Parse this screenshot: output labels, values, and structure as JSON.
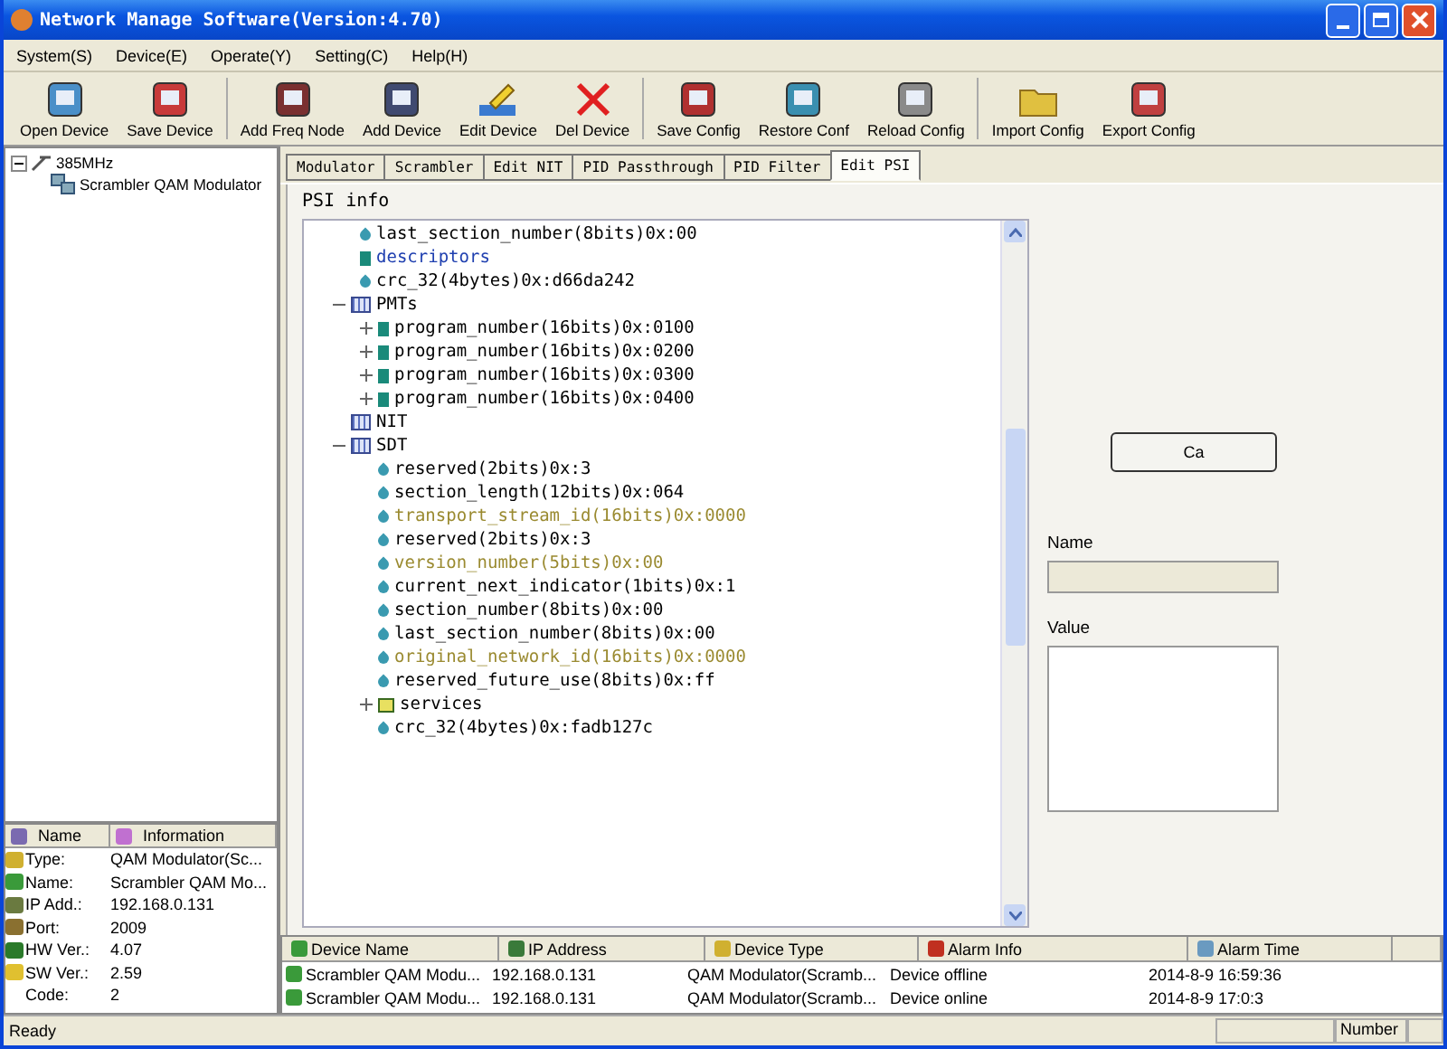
{
  "window": {
    "title": "Network Manage Software(Version:4.70)"
  },
  "menu": [
    "System(S)",
    "Device(E)",
    "Operate(Y)",
    "Setting(C)",
    "Help(H)"
  ],
  "toolbar": [
    {
      "label": "Open Device"
    },
    {
      "label": "Save Device"
    },
    {
      "label": "Add Freq Node"
    },
    {
      "label": "Add Device"
    },
    {
      "label": "Edit Device"
    },
    {
      "label": "Del Device"
    },
    {
      "label": "Save Config"
    },
    {
      "label": "Restore Conf"
    },
    {
      "label": "Reload Config"
    },
    {
      "label": "Import Config"
    },
    {
      "label": "Export Config"
    }
  ],
  "device_tree": {
    "root": {
      "label": "385MHz",
      "expanded": true,
      "children": [
        {
          "label": "Scrambler QAM Modulator"
        }
      ]
    }
  },
  "info": {
    "columns": [
      "Name",
      "Information"
    ],
    "rows": [
      {
        "name": "Type:",
        "value": "QAM Modulator(Sc..."
      },
      {
        "name": "Name:",
        "value": "Scrambler QAM Mo..."
      },
      {
        "name": "IP Add.:",
        "value": "192.168.0.131"
      },
      {
        "name": "Port:",
        "value": "2009"
      },
      {
        "name": "HW Ver.:",
        "value": "4.07"
      },
      {
        "name": "SW Ver.:",
        "value": "2.59"
      },
      {
        "name": "Code:",
        "value": "2"
      }
    ]
  },
  "tabs": [
    {
      "label": "Modulator",
      "selected": false
    },
    {
      "label": "Scrambler",
      "selected": false
    },
    {
      "label": "Edit NIT",
      "selected": false
    },
    {
      "label": "PID Passthrough",
      "selected": false
    },
    {
      "label": "PID Filter",
      "selected": false
    },
    {
      "label": "Edit PSI",
      "selected": true
    }
  ],
  "psi": {
    "title": "PSI info",
    "tree": {
      "continued_items": [
        {
          "label": "last_section_number(8bits)0x:00",
          "kind": "field",
          "highlighted": false
        },
        {
          "label": "descriptors",
          "kind": "descriptor",
          "highlighted": false
        },
        {
          "label": "crc_32(4bytes)0x:d66da242",
          "kind": "field",
          "highlighted": false
        }
      ],
      "nodes": [
        {
          "label": "PMTs",
          "kind": "table",
          "expanded": true,
          "children": [
            {
              "label": "program_number(16bits)0x:0100",
              "kind": "entry",
              "expanded": false,
              "highlighted": false
            },
            {
              "label": "program_number(16bits)0x:0200",
              "kind": "entry",
              "expanded": false,
              "highlighted": false
            },
            {
              "label": "program_number(16bits)0x:0300",
              "kind": "entry",
              "expanded": false,
              "highlighted": false
            },
            {
              "label": "program_number(16bits)0x:0400",
              "kind": "entry",
              "expanded": false,
              "highlighted": false
            }
          ]
        },
        {
          "label": "NIT",
          "kind": "table"
        },
        {
          "label": "SDT",
          "kind": "table",
          "expanded": true,
          "children": [
            {
              "label": "reserved(2bits)0x:3",
              "kind": "field",
              "highlighted": false
            },
            {
              "label": "section_length(12bits)0x:064",
              "kind": "field",
              "highlighted": false
            },
            {
              "label": "transport_stream_id(16bits)0x:0000",
              "kind": "field",
              "highlighted": true
            },
            {
              "label": "reserved(2bits)0x:3",
              "kind": "field",
              "highlighted": false
            },
            {
              "label": "version_number(5bits)0x:00",
              "kind": "field",
              "highlighted": true
            },
            {
              "label": "current_next_indicator(1bits)0x:1",
              "kind": "field",
              "highlighted": false
            },
            {
              "label": "section_number(8bits)0x:00",
              "kind": "field",
              "highlighted": false
            },
            {
              "label": "last_section_number(8bits)0x:00",
              "kind": "field",
              "highlighted": false
            },
            {
              "label": "original_network_id(16bits)0x:0000",
              "kind": "field",
              "highlighted": true
            },
            {
              "label": "reserved_future_use(8bits)0x:ff",
              "kind": "field",
              "highlighted": false
            },
            {
              "label": "services",
              "kind": "folder",
              "expanded": false,
              "highlighted": false
            },
            {
              "label": "crc_32(4bytes)0x:fadb127c",
              "kind": "field",
              "highlighted": false
            }
          ]
        }
      ]
    },
    "button": "Ca",
    "name_label": "Name",
    "value_label": "Value"
  },
  "alarms": {
    "columns": [
      "Device Name",
      "IP Address",
      "Device Type",
      "Alarm Info",
      "Alarm Time"
    ],
    "rows": [
      {
        "device": "Scrambler QAM Modu...",
        "ip": "192.168.0.131",
        "type": "QAM Modulator(Scramb...",
        "info": "Device offline",
        "time": "2014-8-9 16:59:36"
      },
      {
        "device": "Scrambler QAM Modu...",
        "ip": "192.168.0.131",
        "type": "QAM Modulator(Scramb...",
        "info": "Device online",
        "time": "2014-8-9 17:0:3"
      }
    ]
  },
  "status_bar": {
    "text": "Ready",
    "right": "Number"
  }
}
